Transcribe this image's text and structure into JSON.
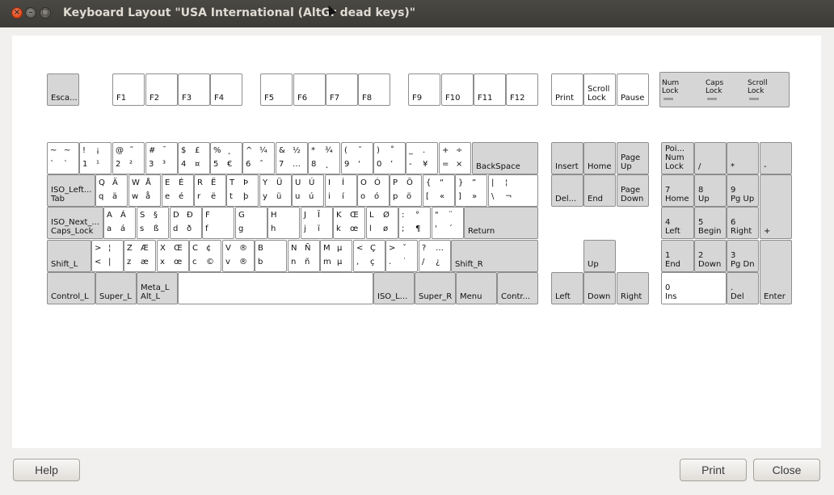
{
  "window": {
    "title": "Keyboard Layout \"USA International (AltGr dead keys)\"",
    "controls": [
      {
        "name": "close",
        "glyph": "×"
      },
      {
        "name": "minimize",
        "glyph": "–"
      },
      {
        "name": "maximize",
        "glyph": "□"
      }
    ]
  },
  "keyboard": {
    "layout": "USA International (AltGr dead keys)",
    "simple_keys": [
      {
        "id": "esc",
        "label": "Esca..."
      },
      {
        "id": "f1",
        "label": "F1"
      },
      {
        "id": "f2",
        "label": "F2"
      },
      {
        "id": "f3",
        "label": "F3"
      },
      {
        "id": "f4",
        "label": "F4"
      },
      {
        "id": "f5",
        "label": "F5"
      },
      {
        "id": "f6",
        "label": "F6"
      },
      {
        "id": "f7",
        "label": "F7"
      },
      {
        "id": "f8",
        "label": "F8"
      },
      {
        "id": "f9",
        "label": "F9"
      },
      {
        "id": "f10",
        "label": "F10"
      },
      {
        "id": "f11",
        "label": "F11"
      },
      {
        "id": "f12",
        "label": "F12"
      },
      {
        "id": "print",
        "label": "Print"
      },
      {
        "id": "scroll",
        "label": "Scroll\nLock"
      },
      {
        "id": "pause",
        "label": "Pause"
      },
      {
        "id": "backspace",
        "label": "BackSpace"
      },
      {
        "id": "tab",
        "label": "ISO_Left...\nTab"
      },
      {
        "id": "caps",
        "label": "ISO_Next_...\nCaps_Lock"
      },
      {
        "id": "return",
        "label": "Return"
      },
      {
        "id": "shift_l",
        "label": "Shift_L"
      },
      {
        "id": "shift_r",
        "label": "Shift_R"
      },
      {
        "id": "ctrl_l",
        "label": "Control_L"
      },
      {
        "id": "super_l",
        "label": "Super_L"
      },
      {
        "id": "alt_l",
        "label": "Meta_L\nAlt_L"
      },
      {
        "id": "space",
        "label": ""
      },
      {
        "id": "iso_l",
        "label": "ISO_L..."
      },
      {
        "id": "super_r",
        "label": "Super_R"
      },
      {
        "id": "menu",
        "label": "Menu"
      },
      {
        "id": "ctrl_r",
        "label": "Contr..."
      },
      {
        "id": "insert",
        "label": "Insert"
      },
      {
        "id": "home",
        "label": "Home"
      },
      {
        "id": "pgup",
        "label": "Page\nUp"
      },
      {
        "id": "delete",
        "label": "Del..."
      },
      {
        "id": "end",
        "label": "End"
      },
      {
        "id": "pgdn",
        "label": "Page\nDown"
      },
      {
        "id": "up",
        "label": "Up"
      },
      {
        "id": "left",
        "label": "Left"
      },
      {
        "id": "down",
        "label": "Down"
      },
      {
        "id": "right",
        "label": "Right"
      },
      {
        "id": "numlock",
        "label": "Poi...\nNum\nLock"
      },
      {
        "id": "kpdiv",
        "label": "/"
      },
      {
        "id": "kpmul",
        "label": "*"
      },
      {
        "id": "kpsub",
        "label": "-"
      },
      {
        "id": "kp7",
        "label": "7\nHome"
      },
      {
        "id": "kp8",
        "label": "8\nUp"
      },
      {
        "id": "kp9",
        "label": "9\nPg Up"
      },
      {
        "id": "kpadd",
        "label": "+"
      },
      {
        "id": "kp4",
        "label": "4\nLeft"
      },
      {
        "id": "kp5",
        "label": "5\nBegin"
      },
      {
        "id": "kp6",
        "label": "6\nRight"
      },
      {
        "id": "kp1",
        "label": "1\nEnd"
      },
      {
        "id": "kp2",
        "label": "2\nDown"
      },
      {
        "id": "kp3",
        "label": "3\nPg Dn"
      },
      {
        "id": "kpenter",
        "label": "Enter"
      },
      {
        "id": "kp0",
        "label": "0\nIns"
      },
      {
        "id": "kpdot",
        "label": ".\nDel"
      }
    ],
    "char_keys": [
      {
        "id": "grave",
        "chars": [
          "~",
          "~",
          "`",
          "`"
        ]
      },
      {
        "id": "k1",
        "chars": [
          "!",
          "¡",
          "1",
          "¹"
        ]
      },
      {
        "id": "k2",
        "chars": [
          "@",
          "˝",
          "2",
          "²"
        ]
      },
      {
        "id": "k3",
        "chars": [
          "#",
          "¯",
          "3",
          "³"
        ]
      },
      {
        "id": "k4",
        "chars": [
          "$",
          "£",
          "4",
          "¤"
        ]
      },
      {
        "id": "k5",
        "chars": [
          "%",
          "¸",
          "5",
          "€"
        ]
      },
      {
        "id": "k6",
        "chars": [
          "^",
          "¼",
          "6",
          "ˆ"
        ]
      },
      {
        "id": "k7",
        "chars": [
          "&",
          "½",
          "7",
          "…"
        ]
      },
      {
        "id": "k8",
        "chars": [
          "*",
          "¾",
          "8",
          "˛"
        ]
      },
      {
        "id": "k9",
        "chars": [
          "(",
          "˘",
          "9",
          "‘"
        ]
      },
      {
        "id": "k0",
        "chars": [
          ")",
          "˚",
          "0",
          "’"
        ]
      },
      {
        "id": "minus",
        "chars": [
          "_",
          ".",
          "-",
          "¥"
        ]
      },
      {
        "id": "equal",
        "chars": [
          "+",
          "÷",
          "=",
          "×"
        ]
      },
      {
        "id": "q",
        "chars": [
          "Q",
          "Ä",
          "q",
          "ä"
        ]
      },
      {
        "id": "w",
        "chars": [
          "W",
          "Å",
          "w",
          "å"
        ]
      },
      {
        "id": "e",
        "chars": [
          "E",
          "É",
          "e",
          "é"
        ]
      },
      {
        "id": "r",
        "chars": [
          "R",
          "Ë",
          "r",
          "ë"
        ]
      },
      {
        "id": "t",
        "chars": [
          "T",
          "Þ",
          "t",
          "þ"
        ]
      },
      {
        "id": "y",
        "chars": [
          "Y",
          "Ü",
          "y",
          "ü"
        ]
      },
      {
        "id": "u",
        "chars": [
          "U",
          "Ú",
          "u",
          "ú"
        ]
      },
      {
        "id": "i",
        "chars": [
          "I",
          "Í",
          "i",
          "í"
        ]
      },
      {
        "id": "o",
        "chars": [
          "O",
          "Ó",
          "o",
          "ó"
        ]
      },
      {
        "id": "p",
        "chars": [
          "P",
          "Ö",
          "p",
          "ö"
        ]
      },
      {
        "id": "lbracket",
        "chars": [
          "{",
          "“",
          "[",
          "«"
        ]
      },
      {
        "id": "rbracket",
        "chars": [
          "}",
          "”",
          "]",
          "»"
        ]
      },
      {
        "id": "backslash",
        "chars": [
          "|",
          "¦",
          "\\",
          "¬"
        ]
      },
      {
        "id": "a",
        "chars": [
          "A",
          "Á",
          "a",
          "á"
        ]
      },
      {
        "id": "s",
        "chars": [
          "S",
          "§",
          "s",
          "ß"
        ]
      },
      {
        "id": "d",
        "chars": [
          "D",
          "Ð",
          "d",
          "ð"
        ]
      },
      {
        "id": "f",
        "chars": [
          "F",
          "",
          "f",
          ""
        ]
      },
      {
        "id": "g",
        "chars": [
          "G",
          "",
          "g",
          ""
        ]
      },
      {
        "id": "h",
        "chars": [
          "H",
          "",
          "h",
          ""
        ]
      },
      {
        "id": "j",
        "chars": [
          "J",
          "Ï",
          "j",
          "ï"
        ]
      },
      {
        "id": "k",
        "chars": [
          "K",
          "Œ",
          "k",
          "œ"
        ]
      },
      {
        "id": "l",
        "chars": [
          "L",
          "Ø",
          "l",
          "ø"
        ]
      },
      {
        "id": "semicolon",
        "chars": [
          ":",
          "°",
          ";",
          "¶"
        ]
      },
      {
        "id": "quote",
        "chars": [
          "\"",
          "¨",
          "'",
          "´"
        ]
      },
      {
        "id": "lsgt",
        "chars": [
          ">",
          "¦",
          "<",
          "|"
        ]
      },
      {
        "id": "z",
        "chars": [
          "Z",
          "Æ",
          "z",
          "æ"
        ]
      },
      {
        "id": "x",
        "chars": [
          "X",
          "Œ",
          "x",
          "œ"
        ]
      },
      {
        "id": "c",
        "chars": [
          "C",
          "¢",
          "c",
          "©"
        ]
      },
      {
        "id": "v",
        "chars": [
          "V",
          "®",
          "v",
          "®"
        ]
      },
      {
        "id": "b",
        "chars": [
          "B",
          "",
          "b",
          ""
        ]
      },
      {
        "id": "n",
        "chars": [
          "N",
          "Ñ",
          "n",
          "ñ"
        ]
      },
      {
        "id": "m",
        "chars": [
          "M",
          "µ",
          "m",
          "µ"
        ]
      },
      {
        "id": "comma",
        "chars": [
          "<",
          "Ç",
          ",",
          "ç"
        ]
      },
      {
        "id": "period",
        "chars": [
          ">",
          "ˇ",
          ".",
          "˙"
        ]
      },
      {
        "id": "slash",
        "chars": [
          "?",
          "…",
          "/",
          "¿"
        ]
      }
    ],
    "indicators": [
      {
        "id": "num",
        "label": "Num\nLock"
      },
      {
        "id": "caps",
        "label": "Caps\nLock"
      },
      {
        "id": "scroll",
        "label": "Scroll\nLock"
      }
    ]
  },
  "footer": {
    "help_label": "Help",
    "print_label": "Print",
    "close_label": "Close"
  }
}
